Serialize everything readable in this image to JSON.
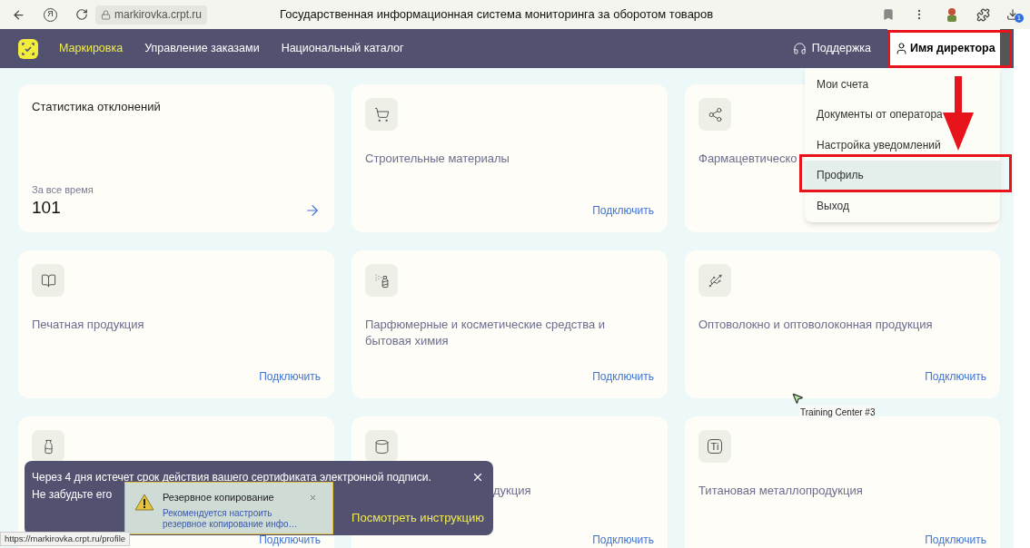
{
  "browser": {
    "logo_letter": "Я",
    "url": "markirovka.crpt.ru",
    "title": "Государственная информационная система мониторинга за оборотом товаров",
    "download_badge": "1"
  },
  "nav": {
    "items": [
      {
        "label": "Маркировка",
        "selected": true
      },
      {
        "label": "Управление заказами",
        "selected": false
      },
      {
        "label": "Национальный каталог",
        "selected": false
      }
    ],
    "support": "Поддержка",
    "user": "Имя директора"
  },
  "user_menu": [
    {
      "label": "Мои счета",
      "selected": false
    },
    {
      "label": "Документы от оператора",
      "selected": false
    },
    {
      "label": "Настройка уведомлений",
      "selected": false
    },
    {
      "label": "Профиль",
      "selected": true
    },
    {
      "label": "Выход",
      "selected": false
    }
  ],
  "cards": [
    {
      "kind": "stats",
      "title": "Статистика отклонений",
      "caption": "За все время",
      "value": "101"
    },
    {
      "kind": "category",
      "title": "Строительные материалы",
      "link": "Подключить"
    },
    {
      "kind": "category",
      "title": "Фармацевтическо"
    },
    {
      "kind": "category",
      "title": "Печатная продукция",
      "link": "Подключить"
    },
    {
      "kind": "category",
      "title": "Парфюмерные и косметические средства и бытовая химия",
      "link": "Подключить"
    },
    {
      "kind": "category",
      "title": "Оптоволокно и оптоволоконная продукция",
      "link": "Подключить"
    },
    {
      "kind": "category",
      "link": "Подключить"
    },
    {
      "kind": "category",
      "title": "дукция",
      "link": "Подключить"
    },
    {
      "kind": "category",
      "icon_text": "Ti",
      "title": "Титановая металлопродукция",
      "link": "Подключить"
    }
  ],
  "toast": {
    "message_lines": [
      "Через 4 дня истечет срок действия вашего сертификата электронной подписи.",
      "Не забудьте его"
    ],
    "link": "Посмотреть инструкцию"
  },
  "backup_notice": {
    "title": "Резервное копирование",
    "text": "Рекомендуется настроить резервное копирование инфо…"
  },
  "status_url": "https://markirovka.crpt.ru/profile",
  "tooltip": "Training Center #3"
}
